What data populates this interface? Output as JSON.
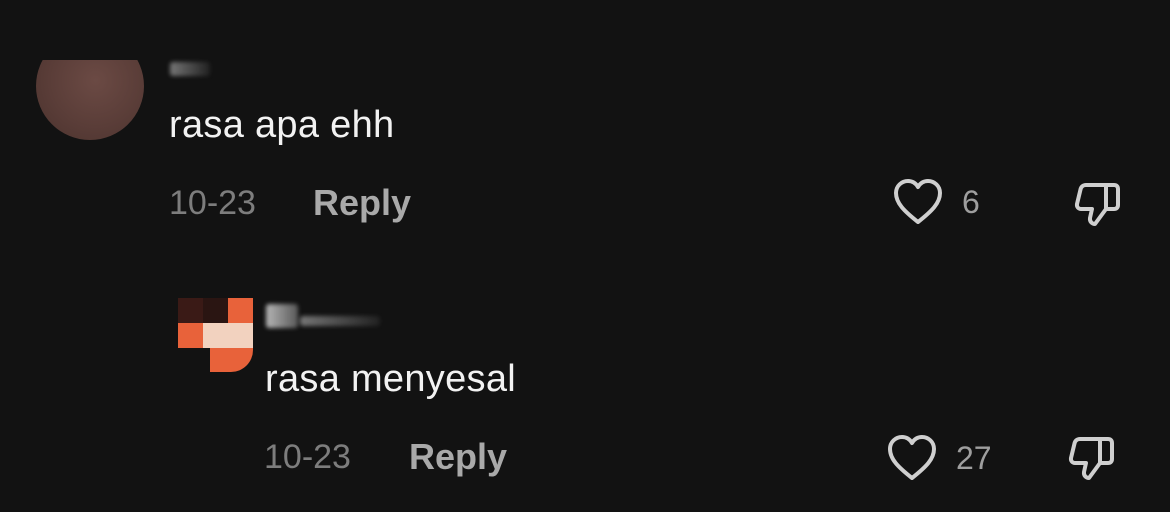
{
  "comments": [
    {
      "text": "rasa apa ehh",
      "date": "10-23",
      "reply_label": "Reply",
      "likes": "6"
    },
    {
      "text": "rasa menyesal",
      "date": "10-23",
      "reply_label": "Reply",
      "likes": "27"
    }
  ],
  "colors": {
    "background": "#121212",
    "text": "#f2f2f2",
    "meta": "#7d7d7d",
    "reply": "#a9a9a9",
    "icon": "#cfcfcf",
    "avatar_orange": "#e8623a",
    "avatar_peach": "#f2d2bf"
  },
  "icons": {
    "like": "heart-outline-icon",
    "dislike": "thumbs-down-icon"
  }
}
